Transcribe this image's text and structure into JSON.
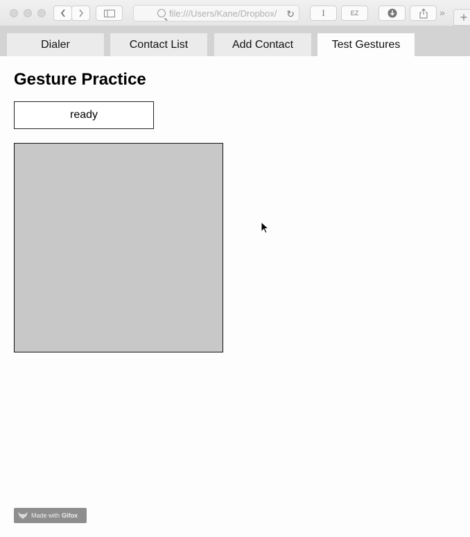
{
  "browser": {
    "url": "file:///Users/Kane/Dropbox/",
    "reader_label": "I",
    "ext_label": "EZ",
    "overflow_label": "»"
  },
  "tabs": [
    {
      "label": "Dialer",
      "active": false
    },
    {
      "label": "Contact List",
      "active": false
    },
    {
      "label": "Add Contact",
      "active": false
    },
    {
      "label": "Test Gestures",
      "active": true
    }
  ],
  "page": {
    "title": "Gesture Practice",
    "status": "ready"
  },
  "watermark": {
    "prefix": "Made with",
    "brand": "Gifox"
  },
  "colors": {
    "gesture_area": "#c8c8c8",
    "tabbar": "#d3d3d3",
    "active_tab": "#fdfdfd"
  }
}
